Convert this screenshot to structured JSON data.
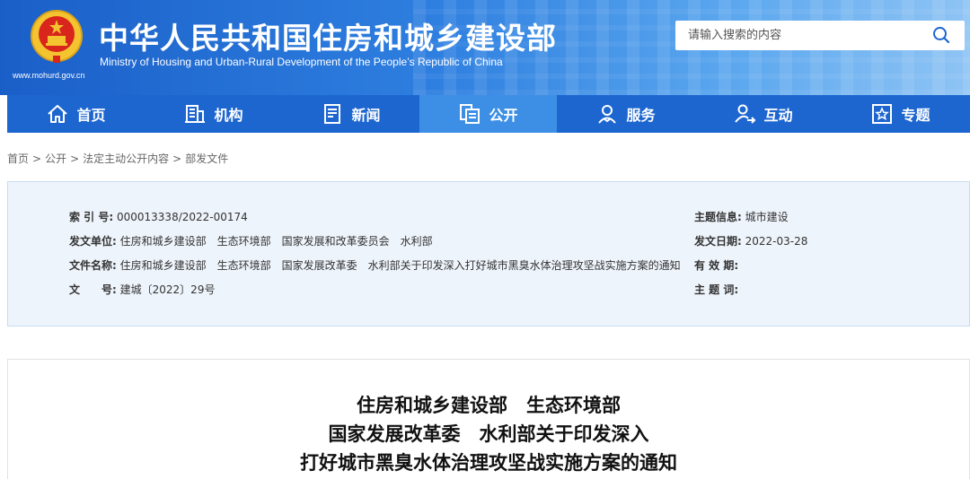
{
  "header": {
    "title": "中华人民共和国住房和城乡建设部",
    "subtitle": "Ministry of Housing and Urban-Rural Development of the People’s Republic of China",
    "url": "www.mohurd.gov.cn",
    "search_placeholder": "请输入搜索的内容"
  },
  "nav": {
    "items": [
      {
        "label": "首页",
        "icon": "home-icon"
      },
      {
        "label": "机构",
        "icon": "building-icon"
      },
      {
        "label": "新闻",
        "icon": "news-icon"
      },
      {
        "label": "公开",
        "icon": "documents-icon",
        "active": true
      },
      {
        "label": "服务",
        "icon": "service-icon"
      },
      {
        "label": "互动",
        "icon": "interaction-icon"
      },
      {
        "label": "专题",
        "icon": "topic-star-icon"
      }
    ]
  },
  "breadcrumb": [
    "首页",
    "公开",
    "法定主动公开内容",
    "部发文件"
  ],
  "info": {
    "index_label": "索 引 号:",
    "index_value": "000013338/2022-00174",
    "issuer_label": "发文单位:",
    "issuer_value": "住房和城乡建设部　生态环境部　国家发展和改革委员会　水利部",
    "docname_label": "文件名称:",
    "docname_value": "住房和城乡建设部　生态环境部　国家发展改革委　水利部关于印发深入打好城市黑臭水体治理攻坚战实施方案的通知",
    "docno_label": "文　　号:",
    "docno_value": "建城〔2022〕29号",
    "theme_label": "主题信息:",
    "theme_value": "城市建设",
    "date_label": "发文日期:",
    "date_value": "2022-03-28",
    "validity_label": "有 效 期:",
    "validity_value": "",
    "keywords_label": "主 题 词:",
    "keywords_value": ""
  },
  "document": {
    "title_lines": [
      "住房和城乡建设部　生态环境部",
      "国家发展改革委　水利部关于印发深入",
      "打好城市黑臭水体治理攻坚战实施方案的通知"
    ]
  },
  "colors": {
    "nav_bg": "#1d66d0",
    "nav_active": "#3d8fe6",
    "info_bg": "#eef4fb"
  }
}
